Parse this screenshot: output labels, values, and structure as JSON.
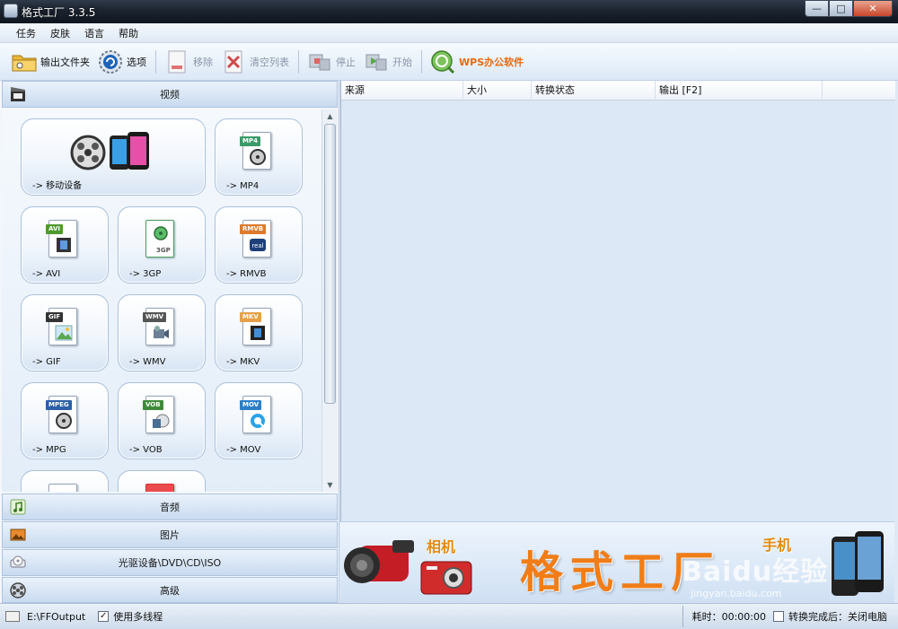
{
  "window": {
    "title": "格式工厂 3.3.5",
    "controls": [
      "—",
      "□",
      "✕"
    ]
  },
  "menu": [
    "任务",
    "皮肤",
    "语言",
    "帮助"
  ],
  "toolbar": {
    "output_folder": "输出文件夹",
    "options": "选项",
    "remove": "移除",
    "clear_list": "清空列表",
    "stop": "停止",
    "start": "开始",
    "wps": "WPS办公软件"
  },
  "categories": {
    "video": "视频",
    "audio": "音频",
    "image": "图片",
    "optical": "光驱设备\\DVD\\CD\\ISO",
    "advanced": "高级"
  },
  "video_items": [
    {
      "label": "-> 移动设备",
      "tag": ""
    },
    {
      "label": "-> MP4",
      "tag": "MP4"
    },
    {
      "label": "-> AVI",
      "tag": "AVI"
    },
    {
      "label": "-> 3GP",
      "tag": "3GP"
    },
    {
      "label": "-> RMVB",
      "tag": "RMVB"
    },
    {
      "label": "-> GIF",
      "tag": "GIF"
    },
    {
      "label": "-> WMV",
      "tag": "WMV"
    },
    {
      "label": "-> MKV",
      "tag": "MKV"
    },
    {
      "label": "-> MPG",
      "tag": "MPEG"
    },
    {
      "label": "-> VOB",
      "tag": "VOB"
    },
    {
      "label": "-> MOV",
      "tag": "MOV"
    }
  ],
  "table_columns": [
    "来源",
    "大小",
    "转换状态",
    "输出 [F2]"
  ],
  "banner": {
    "brand": "格式工厂",
    "camera_label": "相机",
    "phone_label": "手机",
    "watermark": "Baidu经验",
    "watermark_url": "jingyan.baidu.com"
  },
  "status": {
    "output_path": "E:\\FFOutput",
    "multithread_label": "使用多线程",
    "multithread_checked": "✓",
    "elapsed": "耗时：00:00:00",
    "after_convert": "转换完成后：关闭电脑"
  },
  "colors": {
    "accent_orange": "#f07d18",
    "panel_blue": "#dce8f5",
    "title_dark": "#1c2430"
  }
}
